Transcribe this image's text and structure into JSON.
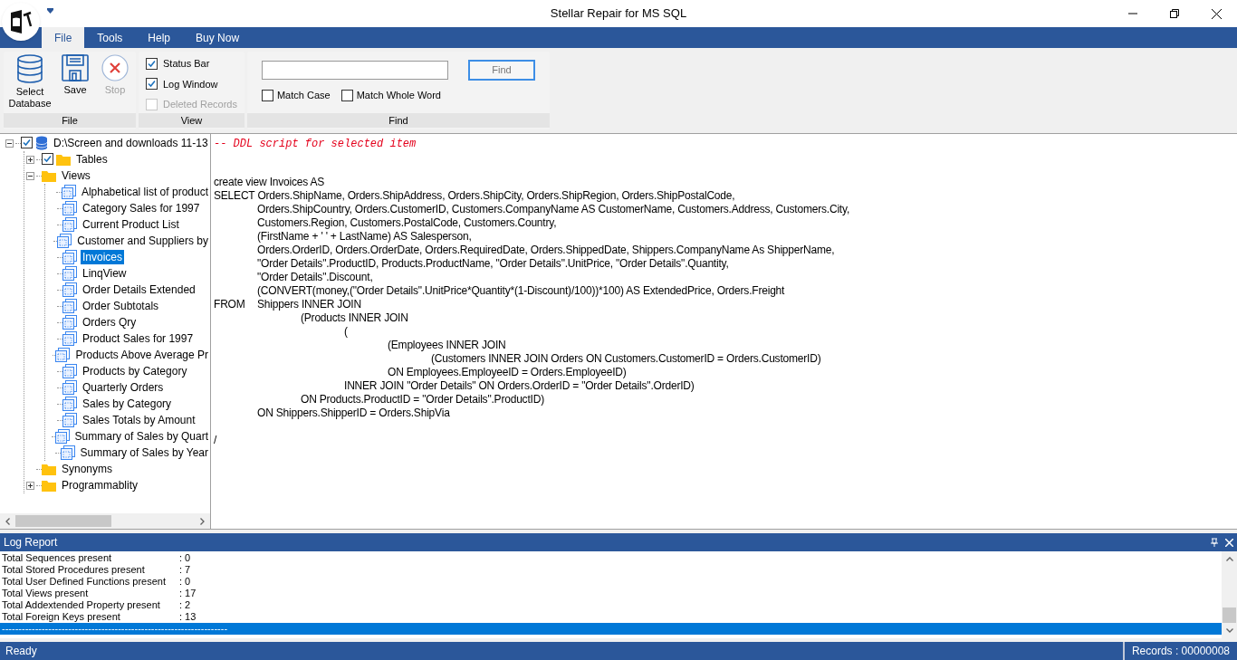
{
  "window": {
    "title": "Stellar Repair for MS SQL"
  },
  "menu_tabs": [
    {
      "label": "File",
      "selected": true
    },
    {
      "label": "Tools",
      "selected": false
    },
    {
      "label": "Help",
      "selected": false
    },
    {
      "label": "Buy Now",
      "selected": false
    }
  ],
  "ribbon": {
    "groups": [
      {
        "kind": "buttons",
        "title": "File",
        "buttons": [
          {
            "label": "Select Database",
            "disabled": false
          },
          {
            "label": "Save",
            "disabled": false
          },
          {
            "label": "Stop",
            "disabled": true
          }
        ]
      },
      {
        "kind": "checks",
        "title": "View",
        "checks": [
          {
            "label": "Status Bar",
            "checked": true,
            "disabled": false
          },
          {
            "label": "Log Window",
            "checked": true,
            "disabled": false
          },
          {
            "label": "Deleted Records",
            "checked": false,
            "disabled": true
          }
        ]
      },
      {
        "kind": "find",
        "title": "Find",
        "button": "Find",
        "options": [
          {
            "label": "Match Case",
            "checked": false
          },
          {
            "label": "Match Whole Word",
            "checked": false
          }
        ]
      }
    ]
  },
  "tree": [
    {
      "label": "D:\\Screen and downloads 11-13",
      "kind": "database",
      "checked": true,
      "expanded": true,
      "selected": false,
      "children": [
        {
          "label": "Tables",
          "kind": "folder",
          "checked": true,
          "expanded": false,
          "selected": false
        },
        {
          "label": "Views",
          "kind": "folder",
          "expanded": true,
          "selected": false,
          "children": [
            {
              "label": "Alphabetical list of product",
              "kind": "view",
              "selected": false
            },
            {
              "label": "Category Sales for 1997",
              "kind": "view",
              "selected": false
            },
            {
              "label": "Current Product List",
              "kind": "view",
              "selected": false
            },
            {
              "label": "Customer and Suppliers by",
              "kind": "view",
              "selected": false
            },
            {
              "label": "Invoices",
              "kind": "view",
              "selected": true
            },
            {
              "label": "LinqView",
              "kind": "view",
              "selected": false
            },
            {
              "label": "Order Details Extended",
              "kind": "view",
              "selected": false
            },
            {
              "label": "Order Subtotals",
              "kind": "view",
              "selected": false
            },
            {
              "label": "Orders Qry",
              "kind": "view",
              "selected": false
            },
            {
              "label": "Product Sales for 1997",
              "kind": "view",
              "selected": false
            },
            {
              "label": "Products Above Average Pr",
              "kind": "view",
              "selected": false
            },
            {
              "label": "Products by Category",
              "kind": "view",
              "selected": false
            },
            {
              "label": "Quarterly Orders",
              "kind": "view",
              "selected": false
            },
            {
              "label": "Sales by Category",
              "kind": "view",
              "selected": false
            },
            {
              "label": "Sales Totals by Amount",
              "kind": "view",
              "selected": false
            },
            {
              "label": "Summary of Sales by Quart",
              "kind": "view",
              "selected": false
            },
            {
              "label": "Summary of Sales by Year",
              "kind": "view",
              "selected": false
            }
          ]
        },
        {
          "label": "Synonyms",
          "kind": "folder",
          "selected": false
        },
        {
          "label": "Programmablity",
          "kind": "folder",
          "expanded": false,
          "selected": false
        }
      ]
    }
  ],
  "script": {
    "comment": "-- DDL script for selected item",
    "lines": [
      "create view Invoices AS",
      "SELECT Orders.ShipName, Orders.ShipAddress, Orders.ShipCity, Orders.ShipRegion, Orders.ShipPostalCode,",
      "\tOrders.ShipCountry, Orders.CustomerID, Customers.CompanyName AS CustomerName, Customers.Address, Customers.City,",
      "\tCustomers.Region, Customers.PostalCode, Customers.Country,",
      "\t(FirstName + ' ' + LastName) AS Salesperson,",
      "\tOrders.OrderID, Orders.OrderDate, Orders.RequiredDate, Orders.ShippedDate, Shippers.CompanyName As ShipperName,",
      "\t\"Order Details\".ProductID, Products.ProductName, \"Order Details\".UnitPrice, \"Order Details\".Quantity,",
      "\t\"Order Details\".Discount,",
      "\t(CONVERT(money,(\"Order Details\".UnitPrice*Quantity*(1-Discount)/100))*100) AS ExtendedPrice, Orders.Freight",
      "FROM\tShippers INNER JOIN",
      "\t\t(Products INNER JOIN",
      "\t\t\t(",
      "\t\t\t\t(Employees INNER JOIN",
      "\t\t\t\t\t(Customers INNER JOIN Orders ON Customers.CustomerID = Orders.CustomerID)",
      "\t\t\t\tON Employees.EmployeeID = Orders.EmployeeID)",
      "\t\t\tINNER JOIN \"Order Details\" ON Orders.OrderID = \"Order Details\".OrderID)",
      "\t\tON Products.ProductID = \"Order Details\".ProductID)",
      "\tON Shippers.ShipperID = Orders.ShipVia"
    ],
    "terminator": "/"
  },
  "log": {
    "title": "Log Report",
    "lines": [
      {
        "label": "Total Sequences present",
        "value": ": 0",
        "selected": false
      },
      {
        "label": "Total Stored Procedures present",
        "value": ": 7",
        "selected": false
      },
      {
        "label": "Total User Defined Functions present",
        "value": ": 0",
        "selected": false
      },
      {
        "label": "Total Views present",
        "value": ": 17",
        "selected": false
      },
      {
        "label": "Total Addextended Property present",
        "value": ": 2",
        "selected": false
      },
      {
        "label": "Total Foreign Keys present",
        "value": ": 13",
        "selected": false
      },
      {
        "label": "--------------------------------------------------------------------",
        "selected": true
      }
    ]
  },
  "status_bar": {
    "left": "Ready",
    "right": "Records : 00000008"
  }
}
